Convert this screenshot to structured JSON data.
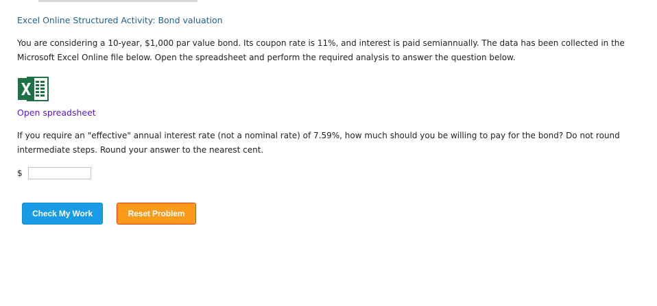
{
  "page": {
    "title": "Excel Online Structured Activity: Bond valuation",
    "intro_text": "You are considering a 10-year, $1,000 par value bond. Its coupon rate is 11%, and interest is paid semiannually. The data has been collected in the Microsoft Excel Online file below. Open the spreadsheet and perform the required analysis to answer the question below.",
    "question_text": "If you require an \"effective\" annual interest rate (not a nominal rate) of 7.59%, how much should you be willing to pay for the bond? Do not round intermediate steps. Round your answer to the nearest cent."
  },
  "spreadsheet": {
    "icon": "excel-icon",
    "link_label": "Open spreadsheet"
  },
  "answer": {
    "currency_symbol": "$",
    "value": ""
  },
  "buttons": {
    "check_label": "Check My Work",
    "reset_label": "Reset Problem"
  },
  "colors": {
    "title": "#1f5f8b",
    "link": "#5a15c4",
    "excel_green": "#1e7145",
    "check_button": "#1a9be6",
    "reset_button": "#fb9a1b",
    "reset_border": "#e6401b"
  }
}
